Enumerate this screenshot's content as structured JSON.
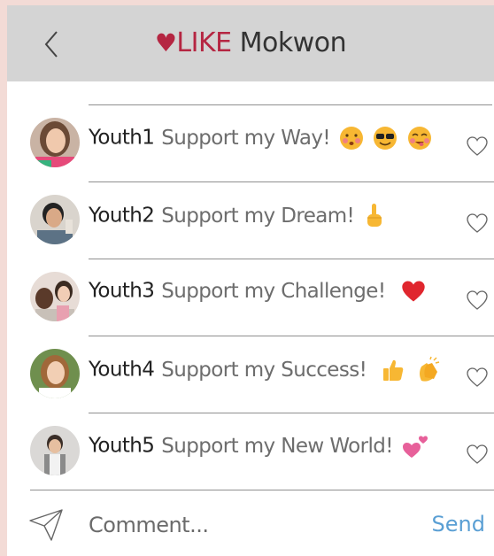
{
  "header": {
    "back_icon": "chevron-left-icon",
    "title_heart": "♥",
    "title_brand": "LIKE",
    "title_name": " Mokwon",
    "brand_color": "#b52642"
  },
  "posts": [
    {
      "name": "Youth1",
      "message": "Support my Way!",
      "emojis": [
        "kissing-face",
        "sunglasses-face",
        "savoring-face"
      ]
    },
    {
      "name": "Youth2",
      "message": "Support my Dream!",
      "emojis": [
        "pointing-up"
      ]
    },
    {
      "name": "Youth3",
      "message": "Support my Challenge!",
      "emojis": [
        "red-heart"
      ]
    },
    {
      "name": "Youth4",
      "message": "Support my Success!",
      "emojis": [
        "thumbs-up",
        "clapping-hands"
      ]
    },
    {
      "name": "Youth5",
      "message": "Support my New World!",
      "emojis": [
        "two-hearts"
      ]
    }
  ],
  "compose": {
    "placeholder": "Comment...",
    "send_label": "Send",
    "send_color": "#5a9fd4"
  }
}
